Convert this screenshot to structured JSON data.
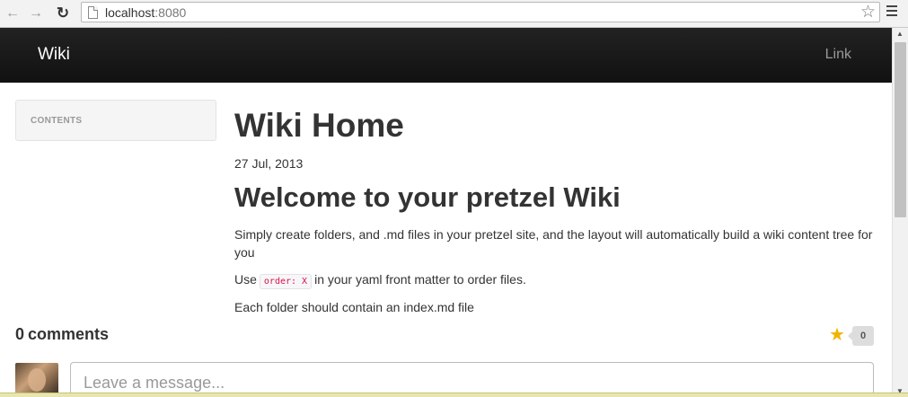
{
  "browser": {
    "back_icon": "arrow-left-icon",
    "forward_icon": "arrow-right-icon",
    "reload_icon": "reload-icon",
    "url_host": "localhost",
    "url_port": ":8080",
    "bookmark_icon": "star-outline-icon",
    "menu_icon": "hamburger-icon"
  },
  "navbar": {
    "brand": "Wiki",
    "link": "Link"
  },
  "sidebar": {
    "header": "CONTENTS"
  },
  "main": {
    "title": "Wiki Home",
    "date": "27 Jul, 2013",
    "heading": "Welcome to your pretzel Wiki",
    "para1": "Simply create folders, and .md files in your pretzel site, and the layout will automatically build a wiki content tree for you",
    "para2_before": "Use",
    "para2_code": "order: X",
    "para2_after": "in your yaml front matter to order files.",
    "para3": "Each folder should contain an index.md file"
  },
  "comments": {
    "count": "0",
    "label": "comments",
    "favorite_count": "0",
    "favorite_color": "#f0b400",
    "input_placeholder": "Leave a message..."
  },
  "colors": {
    "navbar_bg": "#1b1b1b",
    "code_text": "#dd1144",
    "link_muted": "#999999"
  }
}
